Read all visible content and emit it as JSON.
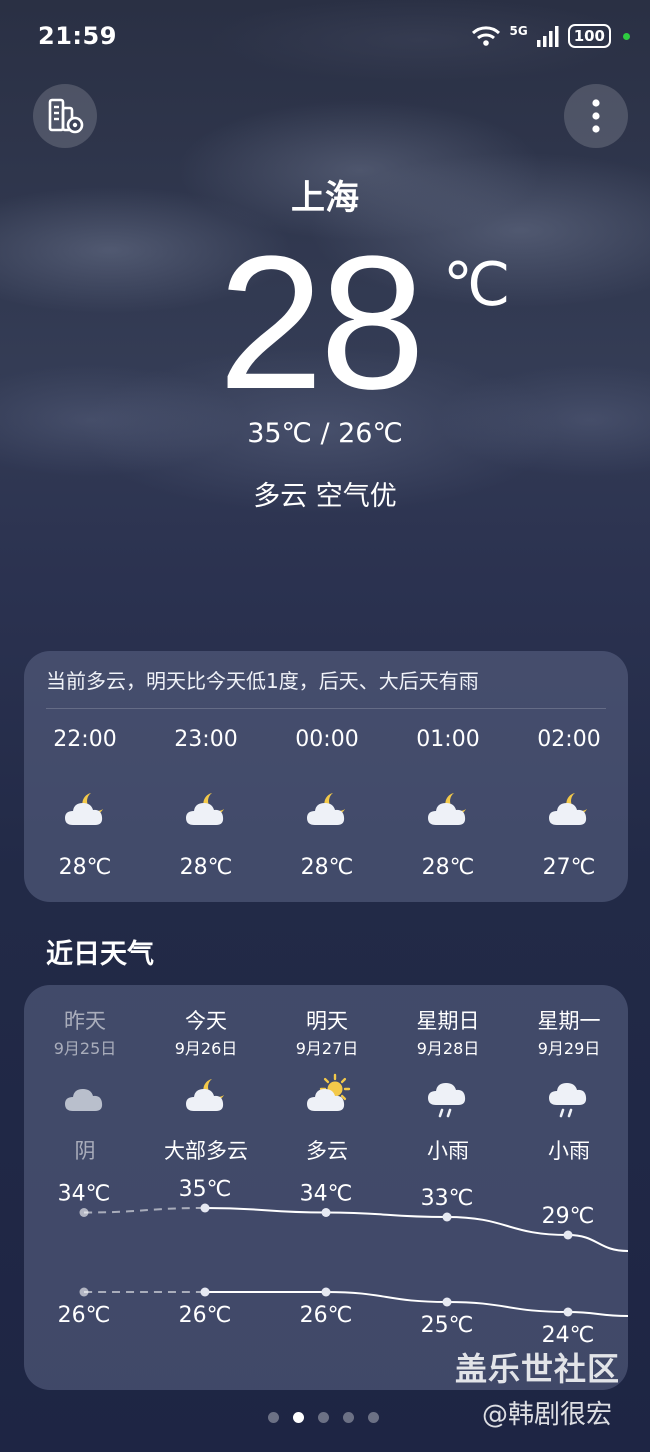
{
  "status": {
    "time": "21:59",
    "network": "5G",
    "battery": "100"
  },
  "location": {
    "city": "上海"
  },
  "current": {
    "temp": "28",
    "unit": "℃",
    "hilo": "35℃ / 26℃",
    "condition": "多云  空气优"
  },
  "hourly": {
    "summary": "当前多云，明天比今天低1度，后天、大后天有雨",
    "items": [
      {
        "time": "22:00",
        "temp": "28℃",
        "icon": "cloudy-night-icon"
      },
      {
        "time": "23:00",
        "temp": "28℃",
        "icon": "cloudy-night-icon"
      },
      {
        "time": "00:00",
        "temp": "28℃",
        "icon": "cloudy-night-icon"
      },
      {
        "time": "01:00",
        "temp": "28℃",
        "icon": "cloudy-night-icon"
      },
      {
        "time": "02:00",
        "temp": "27℃",
        "icon": "cloudy-night-icon"
      }
    ]
  },
  "daily": {
    "title": "近日天气",
    "items": [
      {
        "day": "昨天",
        "date": "9月25日",
        "cond": "阴",
        "high": "34℃",
        "low": "26℃",
        "high_val": 34,
        "low_val": 26,
        "icon": "overcast-icon"
      },
      {
        "day": "今天",
        "date": "9月26日",
        "cond": "大部多云",
        "high": "35℃",
        "low": "26℃",
        "high_val": 35,
        "low_val": 26,
        "icon": "cloudy-night-icon"
      },
      {
        "day": "明天",
        "date": "9月27日",
        "cond": "多云",
        "high": "34℃",
        "low": "26℃",
        "high_val": 34,
        "low_val": 26,
        "icon": "partly-sunny-icon"
      },
      {
        "day": "星期日",
        "date": "9月28日",
        "cond": "小雨",
        "high": "33℃",
        "low": "25℃",
        "high_val": 33,
        "low_val": 25,
        "icon": "light-rain-icon"
      },
      {
        "day": "星期一",
        "date": "9月29日",
        "cond": "小雨",
        "high": "29℃",
        "low": "24℃",
        "high_val": 29,
        "low_val": 24,
        "icon": "light-rain-icon"
      }
    ]
  },
  "watermark": {
    "line1": "盖乐世社区",
    "line2": "@韩剧很宏"
  },
  "pager": {
    "count": 5,
    "active": 2
  }
}
